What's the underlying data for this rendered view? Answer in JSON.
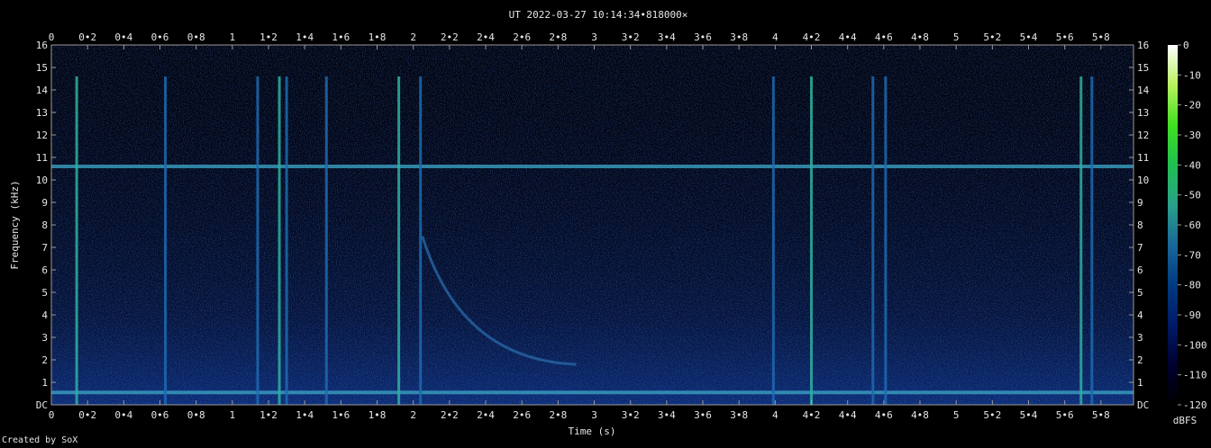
{
  "chart_data": {
    "type": "heatmap",
    "title": "UT 2022-03-27 10:14:34•818000×",
    "xlabel": "Time (s)",
    "ylabel": "Frequency (kHz)",
    "xlim": [
      0,
      5.98
    ],
    "ylim": [
      0,
      16
    ],
    "x_ticks": [
      "0",
      "0•2",
      "0•4",
      "0•6",
      "0•8",
      "1",
      "1•2",
      "1•4",
      "1•6",
      "1•8",
      "2",
      "2•2",
      "2•4",
      "2•6",
      "2•8",
      "3",
      "3•2",
      "3•4",
      "3•6",
      "3•8",
      "4",
      "4•2",
      "4•4",
      "4•6",
      "4•8",
      "5",
      "5•2",
      "5•4",
      "5•6",
      "5•8"
    ],
    "x_tick_values": [
      0,
      0.2,
      0.4,
      0.6,
      0.8,
      1.0,
      1.2,
      1.4,
      1.6,
      1.8,
      2.0,
      2.2,
      2.4,
      2.6,
      2.8,
      3.0,
      3.2,
      3.4,
      3.6,
      3.8,
      4.0,
      4.2,
      4.4,
      4.6,
      4.8,
      5.0,
      5.2,
      5.4,
      5.6,
      5.8
    ],
    "y_ticks": [
      "DC",
      "1",
      "2",
      "3",
      "4",
      "5",
      "6",
      "7",
      "8",
      "9",
      "10",
      "11",
      "12",
      "13",
      "14",
      "15",
      "16"
    ],
    "y_tick_values": [
      0,
      1,
      2,
      3,
      4,
      5,
      6,
      7,
      8,
      9,
      10,
      11,
      12,
      13,
      14,
      15,
      16
    ],
    "colorbar": {
      "label": "dBFS",
      "range": [
        -120,
        0
      ],
      "ticks": [
        "0",
        "-10",
        "-20",
        "-30",
        "-40",
        "-50",
        "-60",
        "-70",
        "-80",
        "-90",
        "-100",
        "-110",
        "-120"
      ],
      "tick_values": [
        0,
        -10,
        -20,
        -30,
        -40,
        -50,
        -60,
        -70,
        -80,
        -90,
        -100,
        -110,
        -120
      ],
      "colors": [
        "#000000",
        "#000030",
        "#001a66",
        "#003a80",
        "#1a6699",
        "#2aa08a",
        "#20c050",
        "#40e020",
        "#b8f060",
        "#ffffff"
      ]
    },
    "horizontal_bands_khz": [
      0.55,
      10.6
    ],
    "vertical_events_s": [
      0.14,
      0.63,
      1.14,
      1.26,
      1.3,
      1.52,
      1.92,
      2.04,
      3.99,
      4.2,
      4.54,
      4.61,
      5.69,
      5.75
    ],
    "whistler": {
      "start_time_s": 2.05,
      "start_khz": 7.5,
      "end_time_s": 2.9,
      "end_khz": 1.8
    }
  },
  "footer": {
    "credit": "Created by SoX"
  }
}
